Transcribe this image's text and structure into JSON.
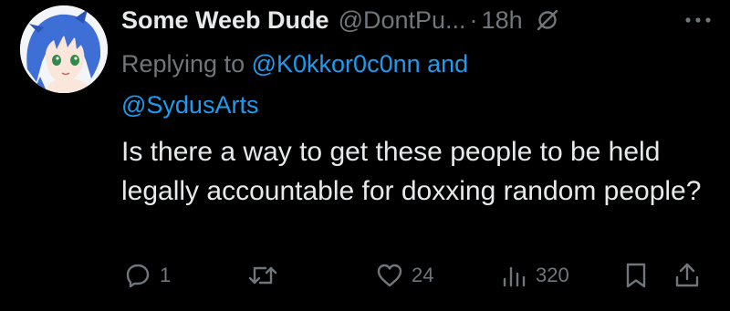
{
  "author": {
    "display_name": "Some Weeb Dude",
    "handle": "@DontPu...",
    "separator": "·",
    "time": "18h"
  },
  "reply": {
    "prefix": "Replying to",
    "mention1": "@K0kkor0c0nn",
    "joiner": "and",
    "mention2": "@SydusArts"
  },
  "tweet": {
    "text": "Is there a way to get these people to be held legally accountable for doxxing random people?"
  },
  "actions": {
    "replies": "1",
    "retweets": "",
    "likes": "24",
    "views": "320"
  },
  "icons": {
    "muted": "muted-icon",
    "more": "more-icon",
    "reply": "reply-icon",
    "retweet": "retweet-icon",
    "like": "heart-icon",
    "views": "views-icon",
    "bookmark": "bookmark-icon",
    "share": "share-icon"
  },
  "colors": {
    "background": "#000000",
    "text": "#e7e9ea",
    "secondary": "#71767b",
    "accent": "#1d9bf0"
  }
}
